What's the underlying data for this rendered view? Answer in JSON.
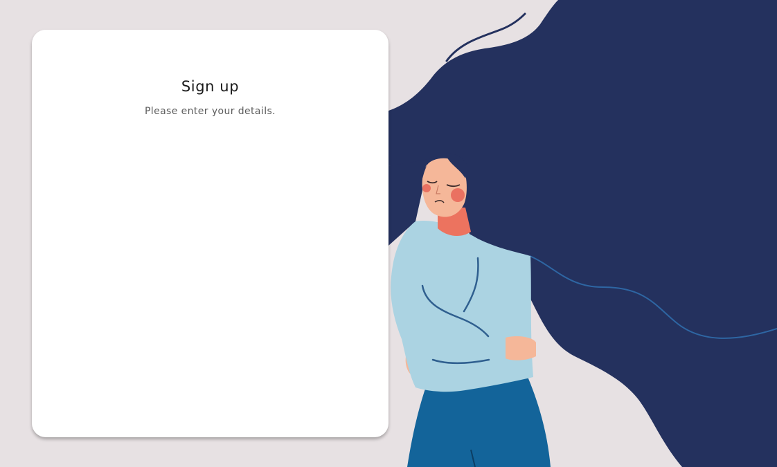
{
  "signup": {
    "title": "Sign up",
    "subtitle": "Please enter your details."
  },
  "colors": {
    "background": "#e7e1e3",
    "card": "#ffffff",
    "hair": "#24315e",
    "sweater": "#abd3e2",
    "skin": "#f5b799",
    "cheek": "#ea7161",
    "neck": "#ec735f",
    "pants": "#13649a",
    "line": "#2f5f8f"
  },
  "illustration": {
    "subject": "woman-with-flowing-hair"
  }
}
